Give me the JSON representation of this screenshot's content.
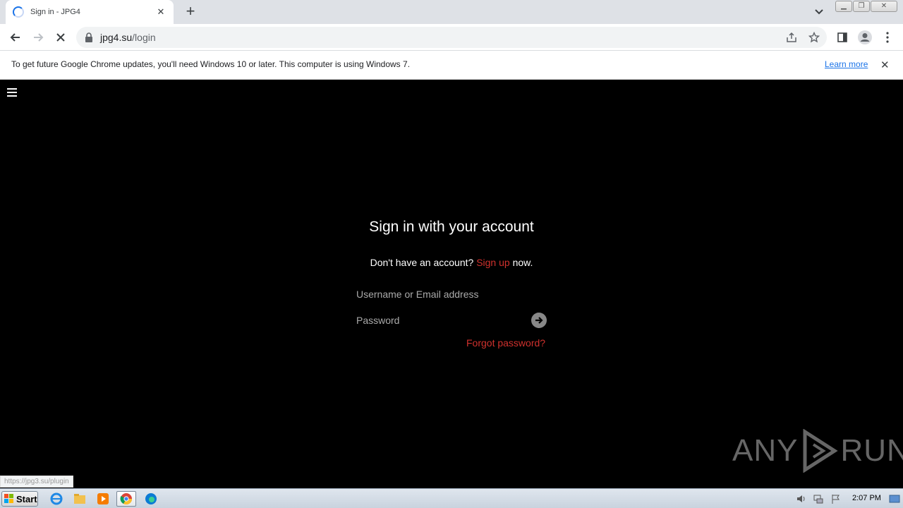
{
  "browser": {
    "tab_title": "Sign in - JPG4",
    "new_tab_label": "+",
    "url_host": "jpg4.su",
    "url_path": "/login"
  },
  "infobar": {
    "message": "To get future Google Chrome updates, you'll need Windows 10 or later. This computer is using Windows 7.",
    "link": "Learn more"
  },
  "login": {
    "title": "Sign in with your account",
    "signup_prefix": "Don't have an account?",
    "signup_link": "Sign up",
    "signup_suffix": "now.",
    "username_placeholder": "Username or Email address",
    "password_placeholder": "Password",
    "forgot_link": "Forgot password?"
  },
  "status_bar": {
    "url": "https://jpg3.su/plugin"
  },
  "watermark": {
    "text": "ANY RUN",
    "left": "ANY",
    "right": "RUN"
  },
  "taskbar": {
    "start_label": "Start",
    "clock": "2:07 PM"
  },
  "colors": {
    "accent_red": "#d0312d",
    "link_blue": "#1a73e8",
    "page_bg": "#000000"
  }
}
